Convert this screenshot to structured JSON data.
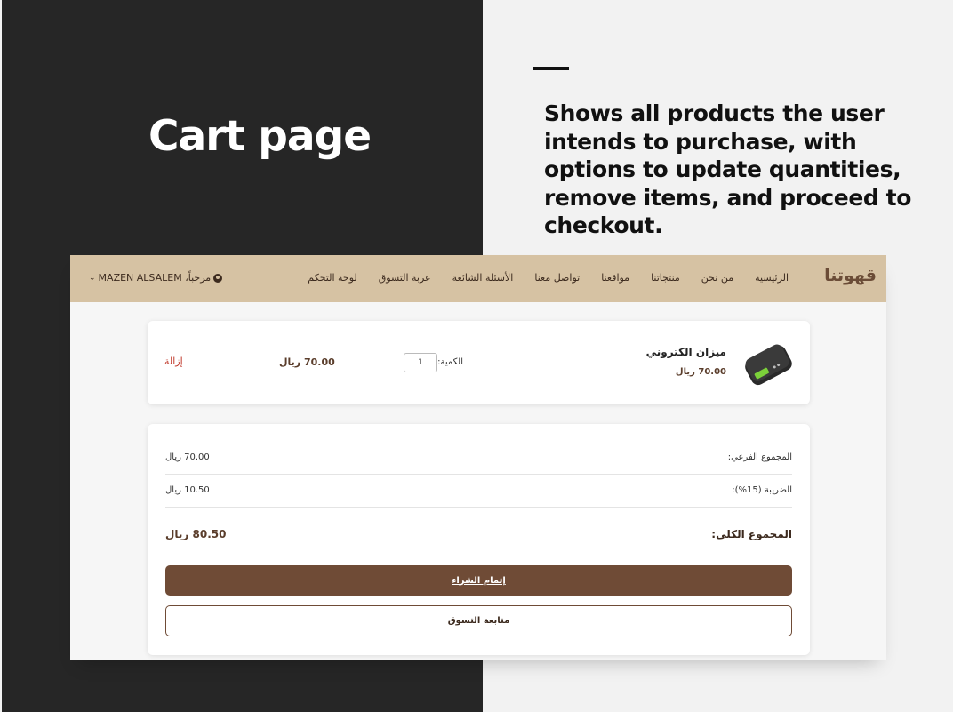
{
  "slide": {
    "title": "Cart page",
    "description": "Shows all products the user intends to purchase, with options to update quantities, remove items, and proceed to checkout."
  },
  "navbar": {
    "logo": "قهوتنا",
    "links": [
      "الرئيسية",
      "من نحن",
      "منتجاتنا",
      "مواقعنا",
      "تواصل معنا",
      "الأسئلة الشائعة",
      "عربة التسوق",
      "لوحة التحكم"
    ],
    "user_greeting": "مرحباً، MAZEN ALSALEM"
  },
  "cart_item": {
    "name": "ميزان الكتروني",
    "price": "70.00 ريال",
    "quantity_label": "الكمية:",
    "quantity_value": "1",
    "line_total": "70.00 ريال",
    "remove_label": "إزالة",
    "image_icon": "digital-scale-image"
  },
  "summary": {
    "subtotal_label": "المجموع الفرعي:",
    "subtotal_value": "70.00 ريال",
    "tax_label": "الضريبة (15%):",
    "tax_value": "10.50 ريال",
    "total_label": "المجموع الكلي:",
    "total_value": "80.50 ريال",
    "checkout_button": "إتمام الشراء",
    "continue_button": "متابعة التسوق"
  },
  "colors": {
    "left_panel": "#262626",
    "navbar": "#d6c2a3",
    "brand_brown": "#6f4b36",
    "remove_red": "#c0392b"
  }
}
